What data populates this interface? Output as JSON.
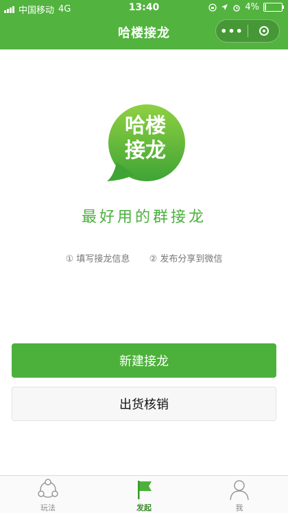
{
  "statusbar": {
    "carrier": "中国移动",
    "network": "4G",
    "time": "13:40",
    "battery": "4%"
  },
  "nav": {
    "title": "哈楼接龙",
    "more_label": "•••"
  },
  "logo": {
    "line1": "哈楼",
    "line2": "接龙"
  },
  "slogan": "最好用的群接龙",
  "steps": [
    "① 填写接龙信息",
    "② 发布分享到微信"
  ],
  "buttons": {
    "new_relay": "新建接龙",
    "verify": "出货核销"
  },
  "tabs": [
    {
      "label": "玩法",
      "icon": "share-icon"
    },
    {
      "label": "发起",
      "icon": "flag-icon",
      "active": true
    },
    {
      "label": "我",
      "icon": "user-icon"
    }
  ],
  "colors": {
    "brand_green": "#52b33f",
    "button_green": "#4cb13a",
    "slogan_green": "#4caf3e"
  }
}
